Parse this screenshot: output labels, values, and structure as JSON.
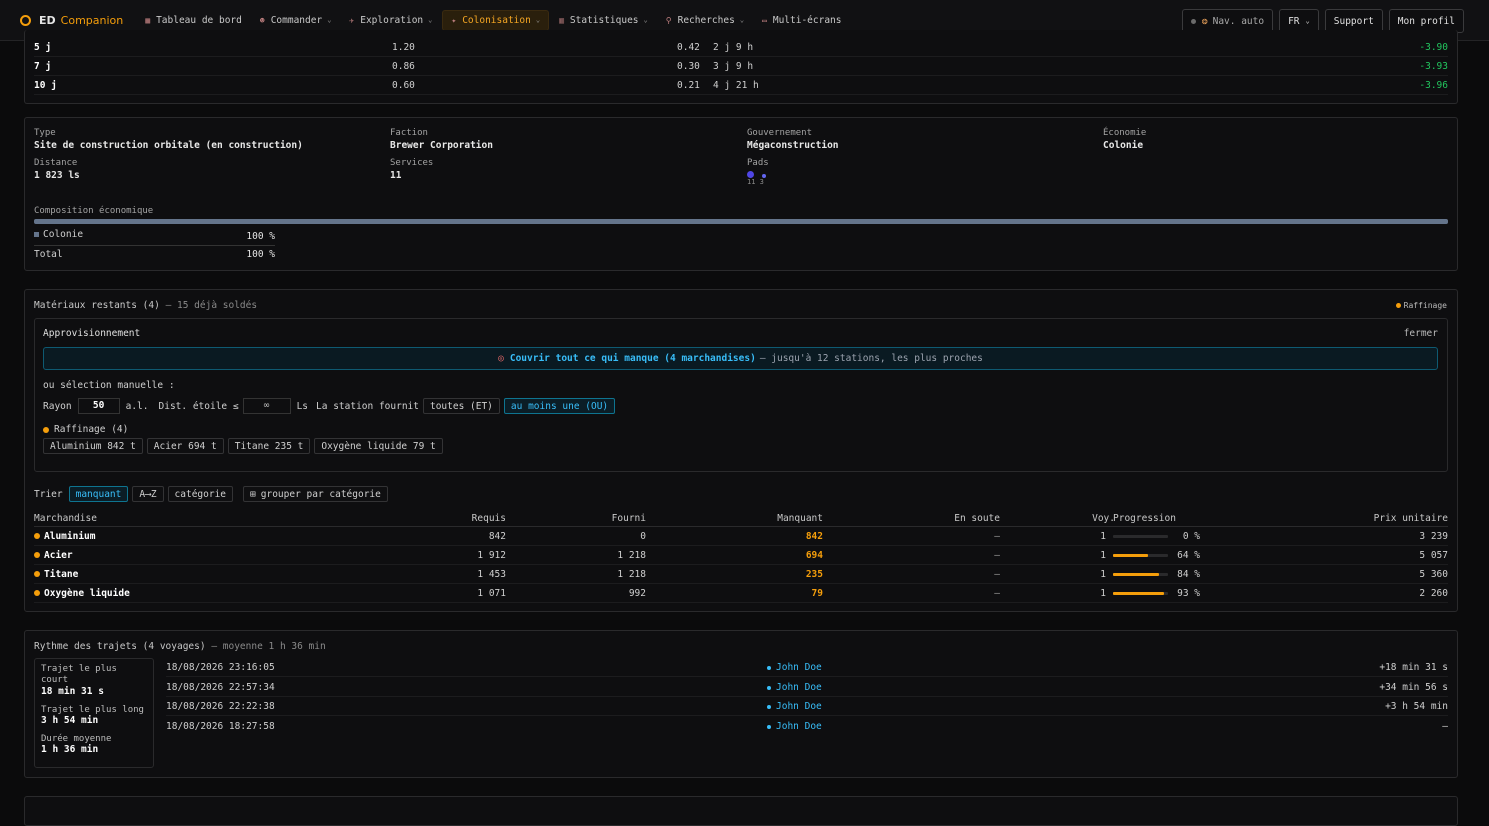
{
  "nav": {
    "logo_left": "ED",
    "logo_right": "Companion",
    "items": [
      {
        "label": "Tableau de bord",
        "chev": false,
        "active": false
      },
      {
        "label": "Commander",
        "chev": true,
        "active": false
      },
      {
        "label": "Exploration",
        "chev": true,
        "active": false
      },
      {
        "label": "Colonisation",
        "chev": true,
        "active": true
      },
      {
        "label": "Statistiques",
        "chev": true,
        "active": false
      },
      {
        "label": "Recherches",
        "chev": true,
        "active": false
      },
      {
        "label": "Multi-écrans",
        "chev": false,
        "active": false
      }
    ],
    "nav_auto": "Nav. auto",
    "lang": "FR",
    "support": "Support",
    "profile": "Mon profil"
  },
  "forecast_rows": [
    {
      "days": "5 j",
      "rate": "1.20",
      "ratio": "0.42",
      "eta": "2 j 9 h",
      "delta": "-3.90"
    },
    {
      "days": "7 j",
      "rate": "0.86",
      "ratio": "0.30",
      "eta": "3 j 9 h",
      "delta": "-3.93"
    },
    {
      "days": "10 j",
      "rate": "0.60",
      "ratio": "0.21",
      "eta": "4 j 21 h",
      "delta": "-3.96"
    }
  ],
  "station": {
    "type_label": "Type",
    "type_value": "Site de construction orbitale (en construction)",
    "faction_label": "Faction",
    "faction_value": "Brewer Corporation",
    "gov_label": "Gouvernement",
    "gov_value": "Mégaconstruction",
    "eco_label": "Économie",
    "eco_value": "Colonie",
    "dist_label": "Distance",
    "dist_value": "1 823 ls",
    "services_label": "Services",
    "services_value": "11",
    "pads_label": "Pads",
    "pads_value": "11 3",
    "composition_label": "Composition économique",
    "composition_fill": 100,
    "comp_rows": [
      {
        "name": "Colonie",
        "pct": "100 %"
      },
      {
        "name": "Total",
        "pct": "100 %"
      }
    ]
  },
  "materials": {
    "title": "Matériaux restants (4)",
    "subtitle": "— 15 déjà soldés",
    "legend": "Raffinage",
    "supply_title": "Approvisionnement",
    "close": "fermer",
    "cover_main": "Couvrir tout ce qui manque (4 marchandises)",
    "cover_rest": "— jusqu'à 12 stations, les plus proches",
    "manual": "ou sélection manuelle :",
    "radius_label": "Rayon",
    "radius_value": "50",
    "radius_unit": "a.l.",
    "star_label": "Dist. étoile ≤",
    "star_value": "∞",
    "star_unit": "Ls",
    "provides_label": "La station fournit",
    "opt_all": "toutes (ET)",
    "opt_any": "au moins une (OU)",
    "group_label": "Raffinage (4)",
    "group_chips": [
      "Aluminium 842 t",
      "Acier 694 t",
      "Titane 235 t",
      "Oxygène liquide 79 t"
    ],
    "sort_label": "Trier",
    "sort_opts": [
      "manquant",
      "A⟶Z",
      "catégorie"
    ],
    "group_by": "grouper par catégorie",
    "headers": {
      "commodity": "Marchandise",
      "required": "Requis",
      "provided": "Fourni",
      "missing": "Manquant",
      "hold": "En soute",
      "trips": "Voy.",
      "progress": "Progression",
      "price": "Prix unitaire"
    },
    "rows": [
      {
        "name": "Aluminium",
        "required": "842",
        "provided": "0",
        "missing": "842",
        "hold": "–",
        "trips": "1",
        "pct": 0,
        "pct_label": "0 %",
        "price": "3 239"
      },
      {
        "name": "Acier",
        "required": "1 912",
        "provided": "1 218",
        "missing": "694",
        "hold": "–",
        "trips": "1",
        "pct": 64,
        "pct_label": "64 %",
        "price": "5 057"
      },
      {
        "name": "Titane",
        "required": "1 453",
        "provided": "1 218",
        "missing": "235",
        "hold": "–",
        "trips": "1",
        "pct": 84,
        "pct_label": "84 %",
        "price": "5 360"
      },
      {
        "name": "Oxygène liquide",
        "required": "1 071",
        "provided": "992",
        "missing": "79",
        "hold": "–",
        "trips": "1",
        "pct": 93,
        "pct_label": "93 %",
        "price": "2 260"
      }
    ]
  },
  "trips": {
    "title": "Rythme des trajets (4 voyages)",
    "subtitle": "— moyenne 1 h 36 min",
    "shortest_label": "Trajet le plus court",
    "shortest_value": "18 min 31 s",
    "longest_label": "Trajet le plus long",
    "longest_value": "3 h 54 min",
    "avg_label": "Durée moyenne",
    "avg_value": "1 h 36 min",
    "rows": [
      {
        "date": "18/08/2026 23:16:05",
        "pilot": "John Doe",
        "delta": "+18 min 31 s"
      },
      {
        "date": "18/08/2026 22:57:34",
        "pilot": "John Doe",
        "delta": "+34 min 56 s"
      },
      {
        "date": "18/08/2026 22:22:38",
        "pilot": "John Doe",
        "delta": "+3 h 54 min"
      },
      {
        "date": "18/08/2026 18:27:58",
        "pilot": "John Doe",
        "delta": "–"
      }
    ]
  },
  "colors": {
    "accent": "#f59e0b",
    "cyan": "#38bdf8",
    "green": "#22c55e",
    "pad_large": "#4f46e5"
  }
}
